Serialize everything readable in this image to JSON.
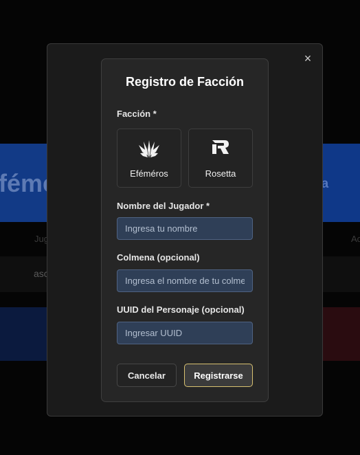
{
  "background": {
    "title_left": "féme",
    "title_right": "tta",
    "header_left": "Jug",
    "header_right": "Ac",
    "cell_left": "asc"
  },
  "dialog": {
    "close_glyph": "×",
    "title": "Registro de Facción",
    "faction_label": "Facción *",
    "factions": [
      {
        "name": "Eféméros",
        "icon": "efemeros-crest-icon"
      },
      {
        "name": "Rosetta",
        "icon": "rosetta-logo-icon"
      }
    ],
    "player_name": {
      "label": "Nombre del Jugador *",
      "placeholder": "Ingresa tu nombre",
      "value": ""
    },
    "hive": {
      "label": "Colmena (opcional)",
      "placeholder": "Ingresa el nombre de tu colmena",
      "value": ""
    },
    "uuid": {
      "label": "UUID del Personaje (opcional)",
      "placeholder": "Ingresar UUID",
      "value": ""
    },
    "cancel_label": "Cancelar",
    "submit_label": "Registrarse"
  },
  "colors": {
    "accent_border": "#d9c271",
    "input_bg": "#2f3f57",
    "bg_blue": "#123a86"
  }
}
